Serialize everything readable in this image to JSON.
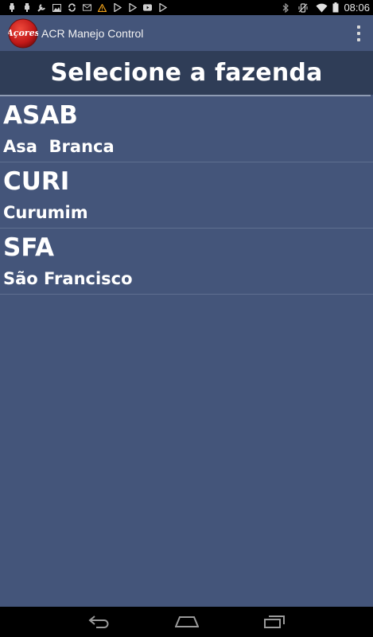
{
  "status_bar": {
    "time": "08:06",
    "left_icons": [
      "usb-icon",
      "usb-icon",
      "wrench-icon",
      "image-icon",
      "sync-icon",
      "gmail-icon",
      "warning-icon",
      "play-store-icon",
      "play-store-icon",
      "youtube-icon",
      "play-store-icon"
    ],
    "right_icons": [
      "bluetooth-icon",
      "vibrate-icon",
      "wifi-icon",
      "battery-icon"
    ]
  },
  "action_bar": {
    "logo_text": "Açores",
    "title": "ACR Manejo Control"
  },
  "header": {
    "title": "Selecione a fazenda"
  },
  "farms": [
    {
      "code": "ASAB",
      "name": "Asa  Branca"
    },
    {
      "code": "CURI",
      "name": "Curumim"
    },
    {
      "code": "SFA",
      "name": "São Francisco"
    }
  ],
  "colors": {
    "background": "#44557a",
    "header_background": "#2f3d57",
    "text": "#ffffff",
    "warning": "#f0a21b"
  }
}
